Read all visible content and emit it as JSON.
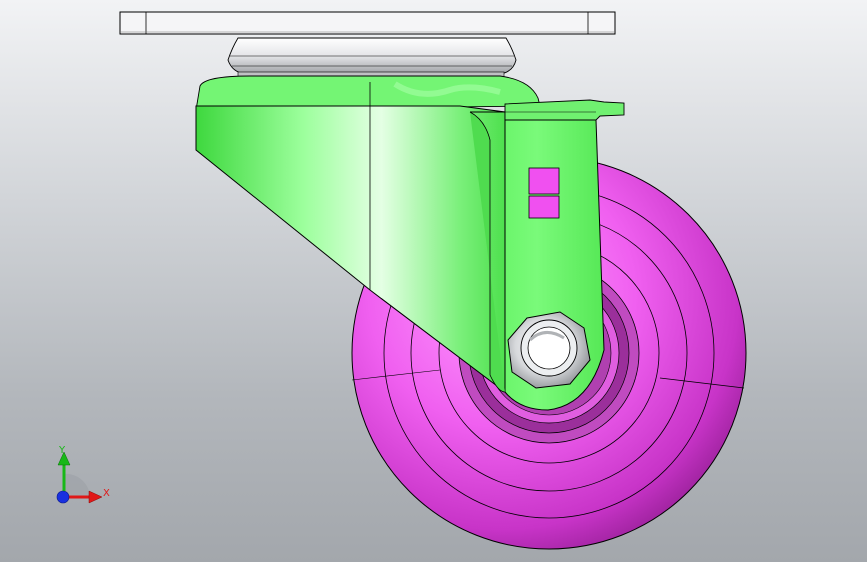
{
  "window": {
    "background_top": "#f2f3f5",
    "background_bottom": "#a3a7ac"
  },
  "model": {
    "name": "swivel-caster",
    "colors": {
      "bracket": "#66f566",
      "bracket_light": "#b8ffb8",
      "bracket_dark": "#34c034",
      "wheel": "#e84be8",
      "wheel_light": "#ff9cff",
      "wheel_dark": "#9c1e9c",
      "top_plate": "#f4f4f6",
      "bearing": "#d9dadd",
      "nut": "#d6d8da",
      "edge": "#000000"
    }
  },
  "triad": {
    "icon": "coordinate-axes-icon",
    "x_label": "X",
    "y_label": "Y",
    "x_color": "#e01818",
    "y_color": "#18b818",
    "z_color": "#1830e0"
  }
}
